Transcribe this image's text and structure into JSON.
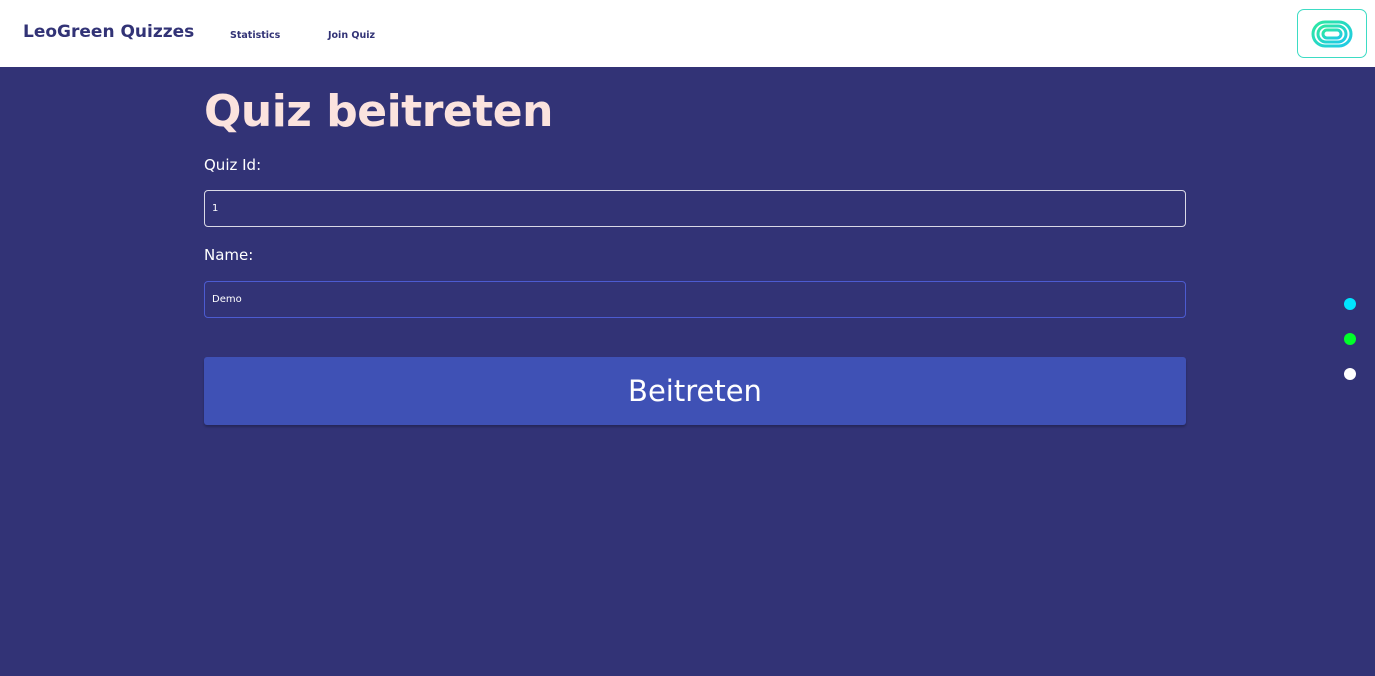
{
  "navbar": {
    "brand": "LeoGreen Quizzes",
    "links": [
      {
        "label": "Statistics"
      },
      {
        "label": "Join Quiz"
      }
    ],
    "logo_icon": "leogreen-logo-icon"
  },
  "main": {
    "title": "Quiz beitreten",
    "quiz_id_label": "Quiz Id:",
    "quiz_id_value": "1",
    "name_label": "Name:",
    "name_value": "Demo",
    "submit_label": "Beitreten"
  },
  "side_dots": [
    {
      "color": "#00e5ff"
    },
    {
      "color": "#00ff2a"
    },
    {
      "color": "#ffffff"
    }
  ],
  "colors": {
    "background": "#323376",
    "navbar": "#ffffff",
    "title": "#fbe3de",
    "button": "#3f51b5",
    "logo_border": "#3ddcc4"
  }
}
